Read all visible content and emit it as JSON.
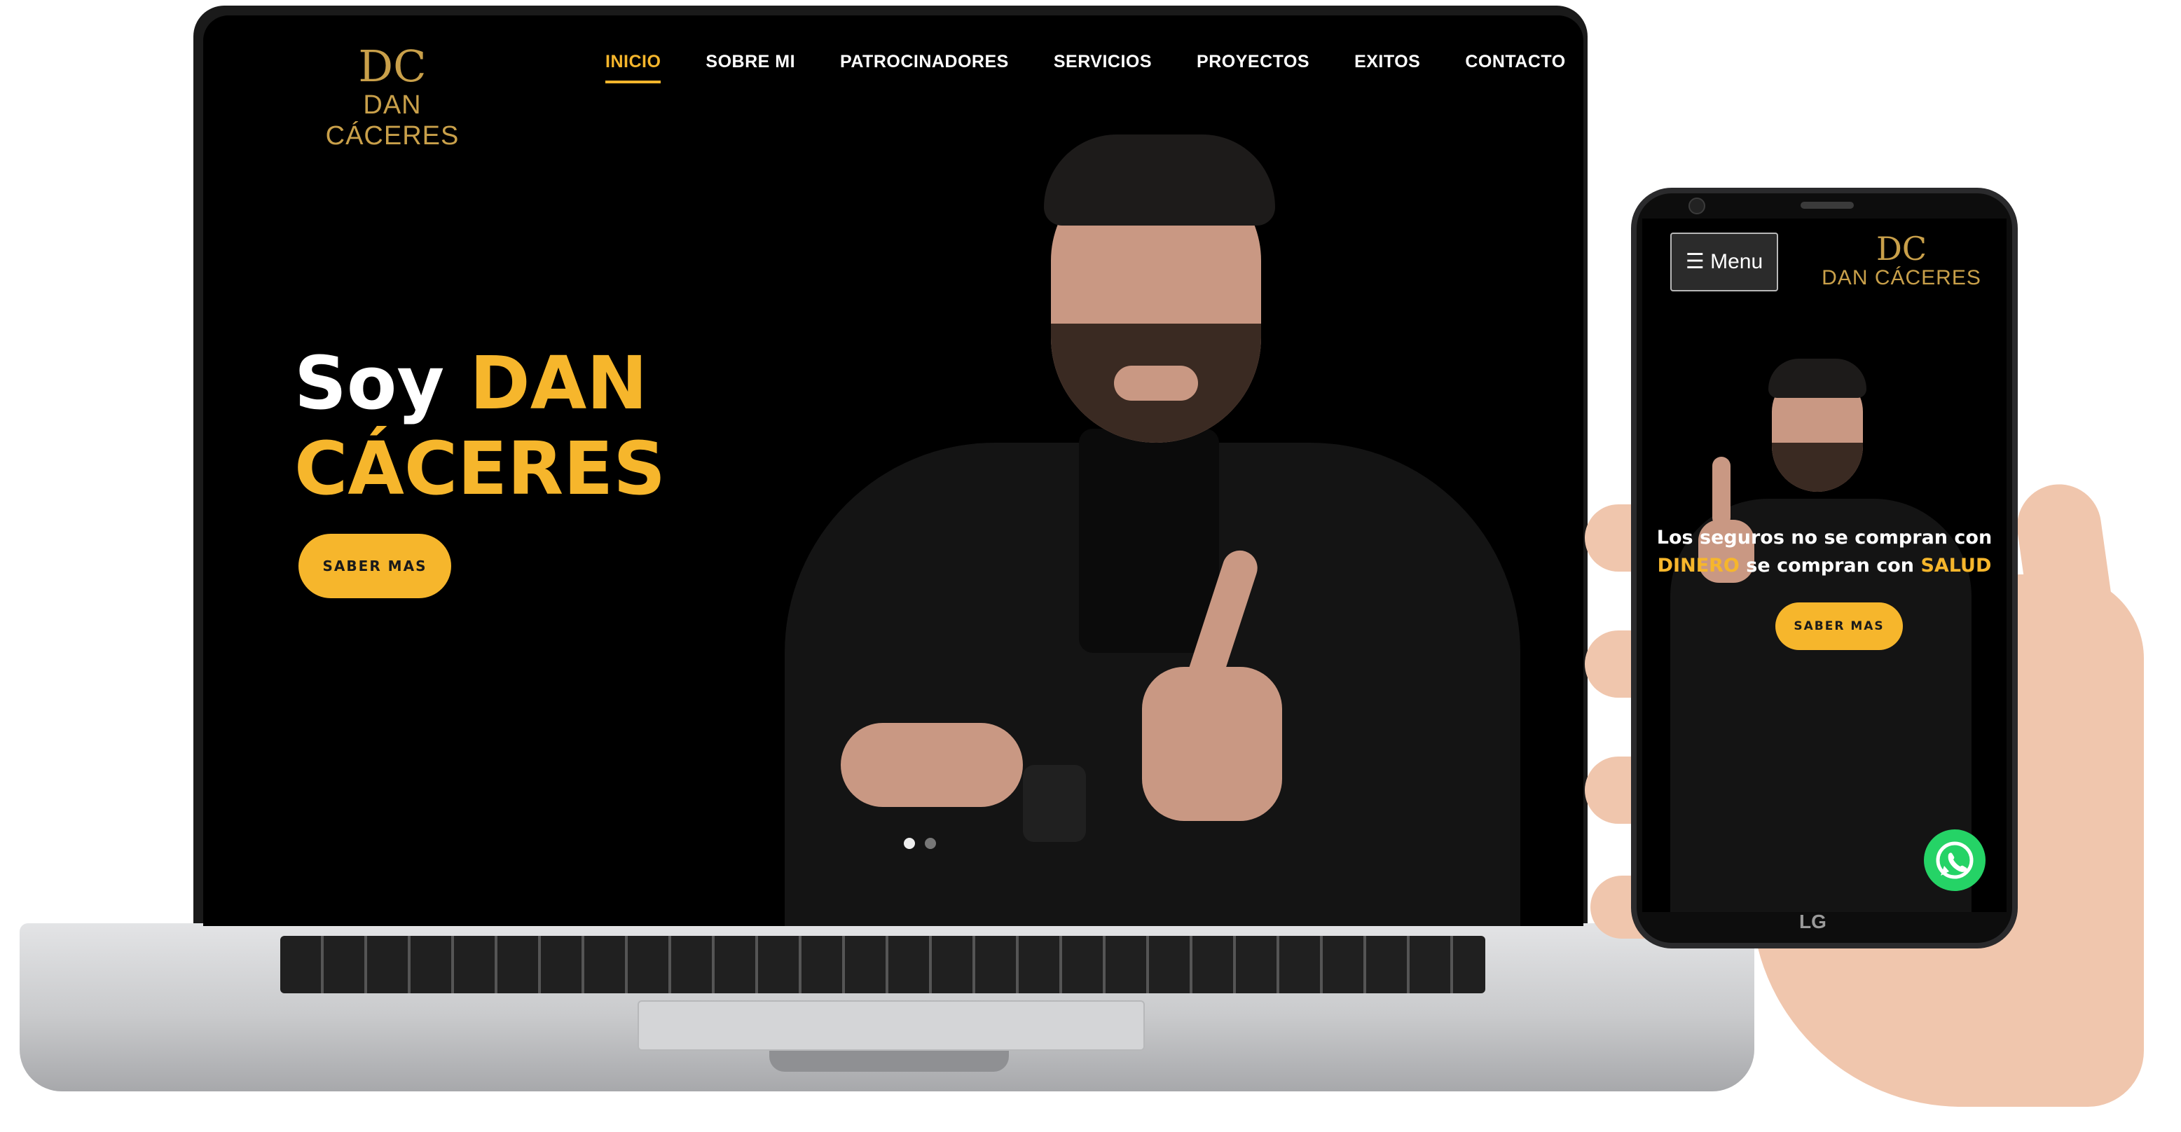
{
  "brand": {
    "monogram": "DC",
    "name": "DAN CÁCERES"
  },
  "desktop": {
    "nav": {
      "items": [
        "INICIO",
        "SOBRE MI",
        "PATROCINADORES",
        "SERVICIOS",
        "PROYECTOS",
        "EXITOS",
        "CONTACTO"
      ],
      "active": "INICIO"
    },
    "hero": {
      "title_prefix": "Soy",
      "title_name_1": "DAN",
      "title_name_2": "CÁCERES",
      "cta_label": "SABER MAS"
    },
    "slider": {
      "slides": 2,
      "active_index": 0
    }
  },
  "mobile": {
    "menu_label": "☰ Menu",
    "headline_line1": "Los seguros no se compran con",
    "headline_word1": "DINERO",
    "headline_mid": "se compran con",
    "headline_word2": "SALUD",
    "cta_label": "SABER MAS",
    "device_brand": "LG"
  },
  "colors": {
    "accent": "#f6b62c",
    "logo_gold": "#c9a04a",
    "background": "#000000",
    "whatsapp": "#25d366"
  },
  "icons": {
    "whatsapp": "whatsapp-icon"
  }
}
